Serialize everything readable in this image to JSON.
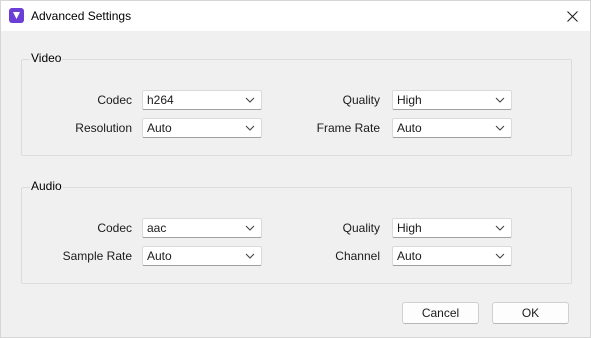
{
  "window": {
    "title": "Advanced Settings",
    "accent_color": "#6b3fd6"
  },
  "video": {
    "group_label": "Video",
    "codec": {
      "label": "Codec",
      "value": "h264"
    },
    "quality": {
      "label": "Quality",
      "value": "High"
    },
    "resolution": {
      "label": "Resolution",
      "value": "Auto"
    },
    "frame_rate": {
      "label": "Frame Rate",
      "value": "Auto"
    }
  },
  "audio": {
    "group_label": "Audio",
    "codec": {
      "label": "Codec",
      "value": "aac"
    },
    "quality": {
      "label": "Quality",
      "value": "High"
    },
    "sample_rate": {
      "label": "Sample Rate",
      "value": "Auto"
    },
    "channel": {
      "label": "Channel",
      "value": "Auto"
    }
  },
  "buttons": {
    "cancel": "Cancel",
    "ok": "OK"
  }
}
